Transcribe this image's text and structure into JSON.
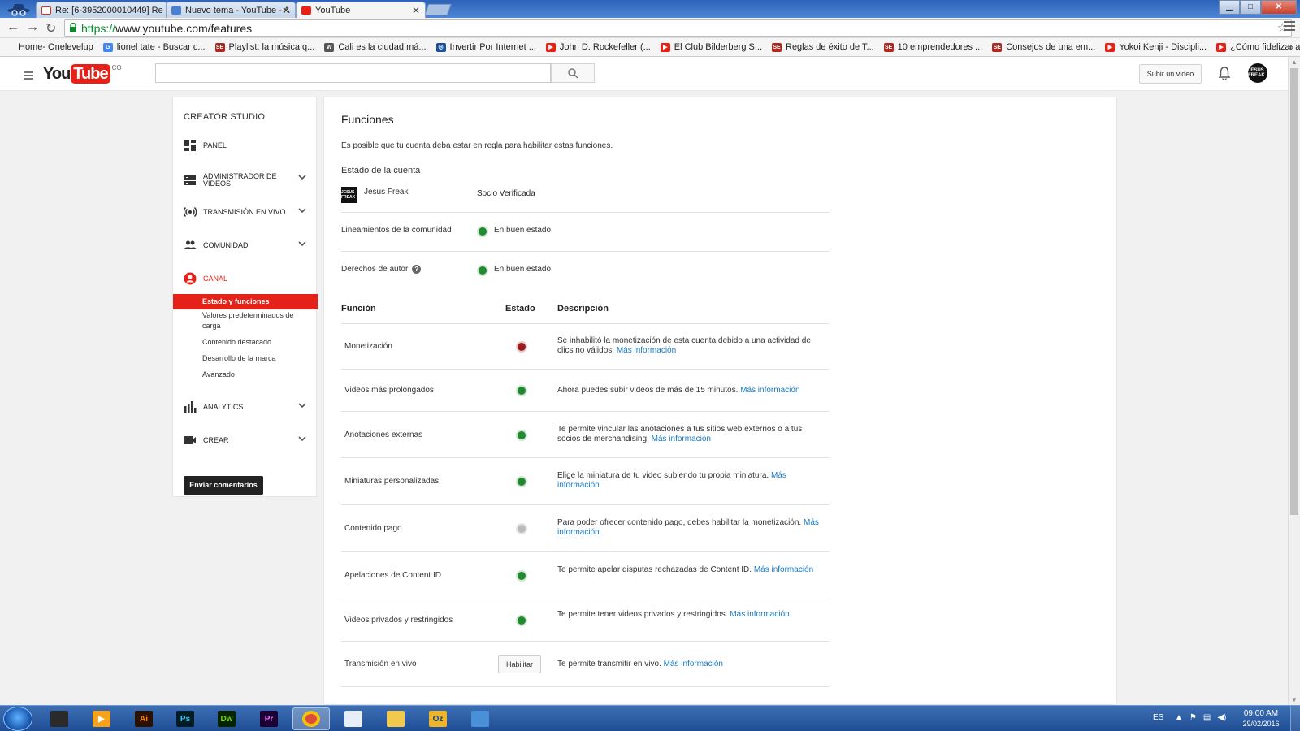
{
  "browser": {
    "tabs": [
      {
        "title": "Re: [6-3952000010449] Re",
        "favicon_color": "#d93025"
      },
      {
        "title": "Nuevo tema - YouTube - A",
        "favicon_color": "#4a7fd6"
      },
      {
        "title": "YouTube",
        "favicon_color": "#e62117"
      }
    ],
    "window_buttons": {
      "minimize": "▁",
      "maximize": "□",
      "close": "✕"
    },
    "url_scheme": "https://",
    "url_rest": "www.youtube.com/features",
    "bookmarks": [
      {
        "label": "Home- Onelevelup",
        "icon": "",
        "color": ""
      },
      {
        "label": "lionel tate - Buscar c...",
        "icon": "G",
        "color": "#4285f4"
      },
      {
        "label": "Playlist: la música q...",
        "icon": "SE",
        "color": "#b3261e"
      },
      {
        "label": "Cali es la ciudad má...",
        "icon": "W",
        "color": "#555555"
      },
      {
        "label": "Invertir Por Internet ...",
        "icon": "◎",
        "color": "#1a4f9c"
      },
      {
        "label": "John D. Rockefeller (...",
        "icon": "▶",
        "color": "#e62117"
      },
      {
        "label": "El Club Bilderberg S...",
        "icon": "▶",
        "color": "#e62117"
      },
      {
        "label": "Reglas de éxito de T...",
        "icon": "SE",
        "color": "#b3261e"
      },
      {
        "label": "10 emprendedores ...",
        "icon": "SE",
        "color": "#b3261e"
      },
      {
        "label": "Consejos de una em...",
        "icon": "SE",
        "color": "#b3261e"
      },
      {
        "label": "Yokoi Kenji - Discipli...",
        "icon": "▶",
        "color": "#e62117"
      },
      {
        "label": "¿Cómo fidelizar a mi...",
        "icon": "▶",
        "color": "#e62117"
      }
    ]
  },
  "header": {
    "logo_you": "You",
    "logo_tube": "Tube",
    "logo_country": "CO",
    "upload_label": "Subir un video",
    "avatar_text": "JESUS FREAK"
  },
  "sidebar": {
    "title": "CREATOR STUDIO",
    "items": [
      {
        "label": "PANEL"
      },
      {
        "label": "ADMINISTRADOR DE VIDEOS"
      },
      {
        "label": "TRANSMISIÓN EN VIVO"
      },
      {
        "label": "COMUNIDAD"
      },
      {
        "label": "CANAL"
      },
      {
        "label": "ANALYTICS"
      },
      {
        "label": "CREAR"
      }
    ],
    "canal_sub": [
      {
        "label": "Estado y funciones"
      },
      {
        "label": "Valores predeterminados de carga"
      },
      {
        "label": "Contenido destacado"
      },
      {
        "label": "Desarrollo de la marca"
      },
      {
        "label": "Avanzado"
      }
    ],
    "feedback_label": "Enviar comentarios"
  },
  "main": {
    "title": "Funciones",
    "subtitle": "Es posible que tu cuenta deba estar en regla para habilitar estas funciones.",
    "account_heading": "Estado de la cuenta",
    "account_name": "Jesus Freak",
    "account_status": "Socio Verificada",
    "status_rows": [
      {
        "label": "Lineamientos de la comunidad",
        "value": "En buen estado",
        "state": "green"
      },
      {
        "label": "Derechos de autor",
        "value": "En buen estado",
        "state": "green"
      }
    ],
    "headers": {
      "function": "Función",
      "state": "Estado",
      "description": "Descripción"
    },
    "features": [
      {
        "name": "Monetización",
        "state": "red",
        "desc": "Se inhabilitó la monetización de esta cuenta debido a una actividad de clics no válidos.",
        "link": "Más información"
      },
      {
        "name": "Videos más prolongados",
        "state": "green",
        "desc": "Ahora puedes subir videos de más de 15 minutos.",
        "link": "Más información"
      },
      {
        "name": "Anotaciones externas",
        "state": "green",
        "desc": "Te permite vincular las anotaciones a tus sitios web externos o a tus socios de merchandising.",
        "link": "Más información"
      },
      {
        "name": "Miniaturas personalizadas",
        "state": "green",
        "desc": "Elige la miniatura de tu video subiendo tu propia miniatura.",
        "link": "Más información"
      },
      {
        "name": "Contenido pago",
        "state": "gray",
        "desc": "Para poder ofrecer contenido pago, debes habilitar la monetización.",
        "link": "Más información"
      },
      {
        "name": "Apelaciones de Content ID",
        "state": "green",
        "desc": "Te permite apelar disputas rechazadas de Content ID.",
        "link": "Más información"
      },
      {
        "name": "Videos privados y restringidos",
        "state": "green",
        "desc": "Te permite tener videos privados y restringidos.",
        "link": "Más información"
      },
      {
        "name": "Transmisión en vivo",
        "state": "button",
        "button_label": "Habilitar",
        "desc": "Te permite transmitir en vivo.",
        "link": "Más información"
      }
    ]
  },
  "taskbar": {
    "apps": [
      {
        "name": "apps-grid",
        "label": "",
        "bg": "#2a2a2a",
        "fg": "#ff9800"
      },
      {
        "name": "media-player",
        "label": "▶",
        "bg": "#f6a21a",
        "fg": "#ffffff"
      },
      {
        "name": "illustrator",
        "label": "Ai",
        "bg": "#2b1100",
        "fg": "#ff7c00"
      },
      {
        "name": "photoshop",
        "label": "Ps",
        "bg": "#001d26",
        "fg": "#31c5f0"
      },
      {
        "name": "dreamweaver",
        "label": "Dw",
        "bg": "#072401",
        "fg": "#7bd320"
      },
      {
        "name": "premiere",
        "label": "Pr",
        "bg": "#1d0033",
        "fg": "#e77bff"
      },
      {
        "name": "chrome",
        "label": "",
        "bg": "#dd4b39",
        "fg": "#ffffff"
      },
      {
        "name": "notepad",
        "label": "",
        "bg": "#e8eef7",
        "fg": "#333333"
      },
      {
        "name": "explorer",
        "label": "",
        "bg": "#f2c94c",
        "fg": "#333333"
      },
      {
        "name": "outlook",
        "label": "Oz",
        "bg": "#f0b429",
        "fg": "#0b4a8b"
      },
      {
        "name": "window-app",
        "label": "",
        "bg": "#4a90d9",
        "fg": "#ffffff"
      }
    ],
    "language": "ES",
    "time": "09:00 AM",
    "date": "29/02/2016"
  }
}
